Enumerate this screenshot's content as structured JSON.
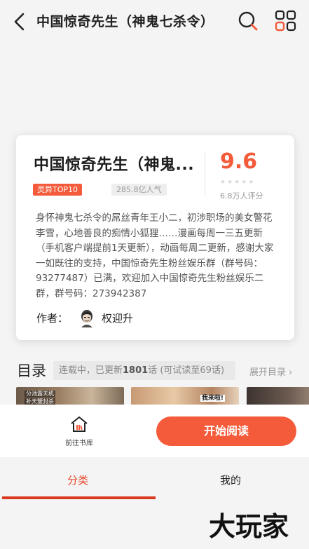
{
  "header": {
    "title": "中国惊奇先生（神鬼七杀令）",
    "back_icon": "chevron-left-icon",
    "search_icon": "search-icon",
    "apps_icon": "apps-grid-icon",
    "accent_color": "#f35b3a"
  },
  "card": {
    "title": "中国惊奇先生（神鬼...",
    "badge_rank": "灵异TOP10",
    "badge_popularity": "285.8亿人气",
    "score": "9.6",
    "rating_count": "6.8万人评分",
    "description": "身怀神鬼七杀令的屌丝青年王小二，初涉职场的美女警花李雪，心地善良的痴情小狐狸……漫画每周一三五更新（手机客户端提前1天更新），动画每周二更新，感谢大家一如既往的支持，中国惊奇先生粉丝娱乐群（群号码：93277487）已满，欢迎加入中国惊奇先生粉丝娱乐二群，群号码：273942387",
    "author_label": "作者：",
    "author_name": "权迎升"
  },
  "toc": {
    "title": "目录",
    "status_prefix": "连载中，已更新",
    "status_count": "1801",
    "status_suffix": "话 (可试读至69话)",
    "expand_label": "展开目录 ›",
    "thumb1_cap1": "分池露天机",
    "thumb1_cap2": "补天鑒封杀",
    "thumb2_cap": "我来啦!"
  },
  "actions": {
    "library_label": "前往书库",
    "read_label": "开始阅读"
  },
  "tabs": {
    "category": "分类",
    "mine": "我的",
    "active": "分类"
  },
  "watermark": "大玩家"
}
